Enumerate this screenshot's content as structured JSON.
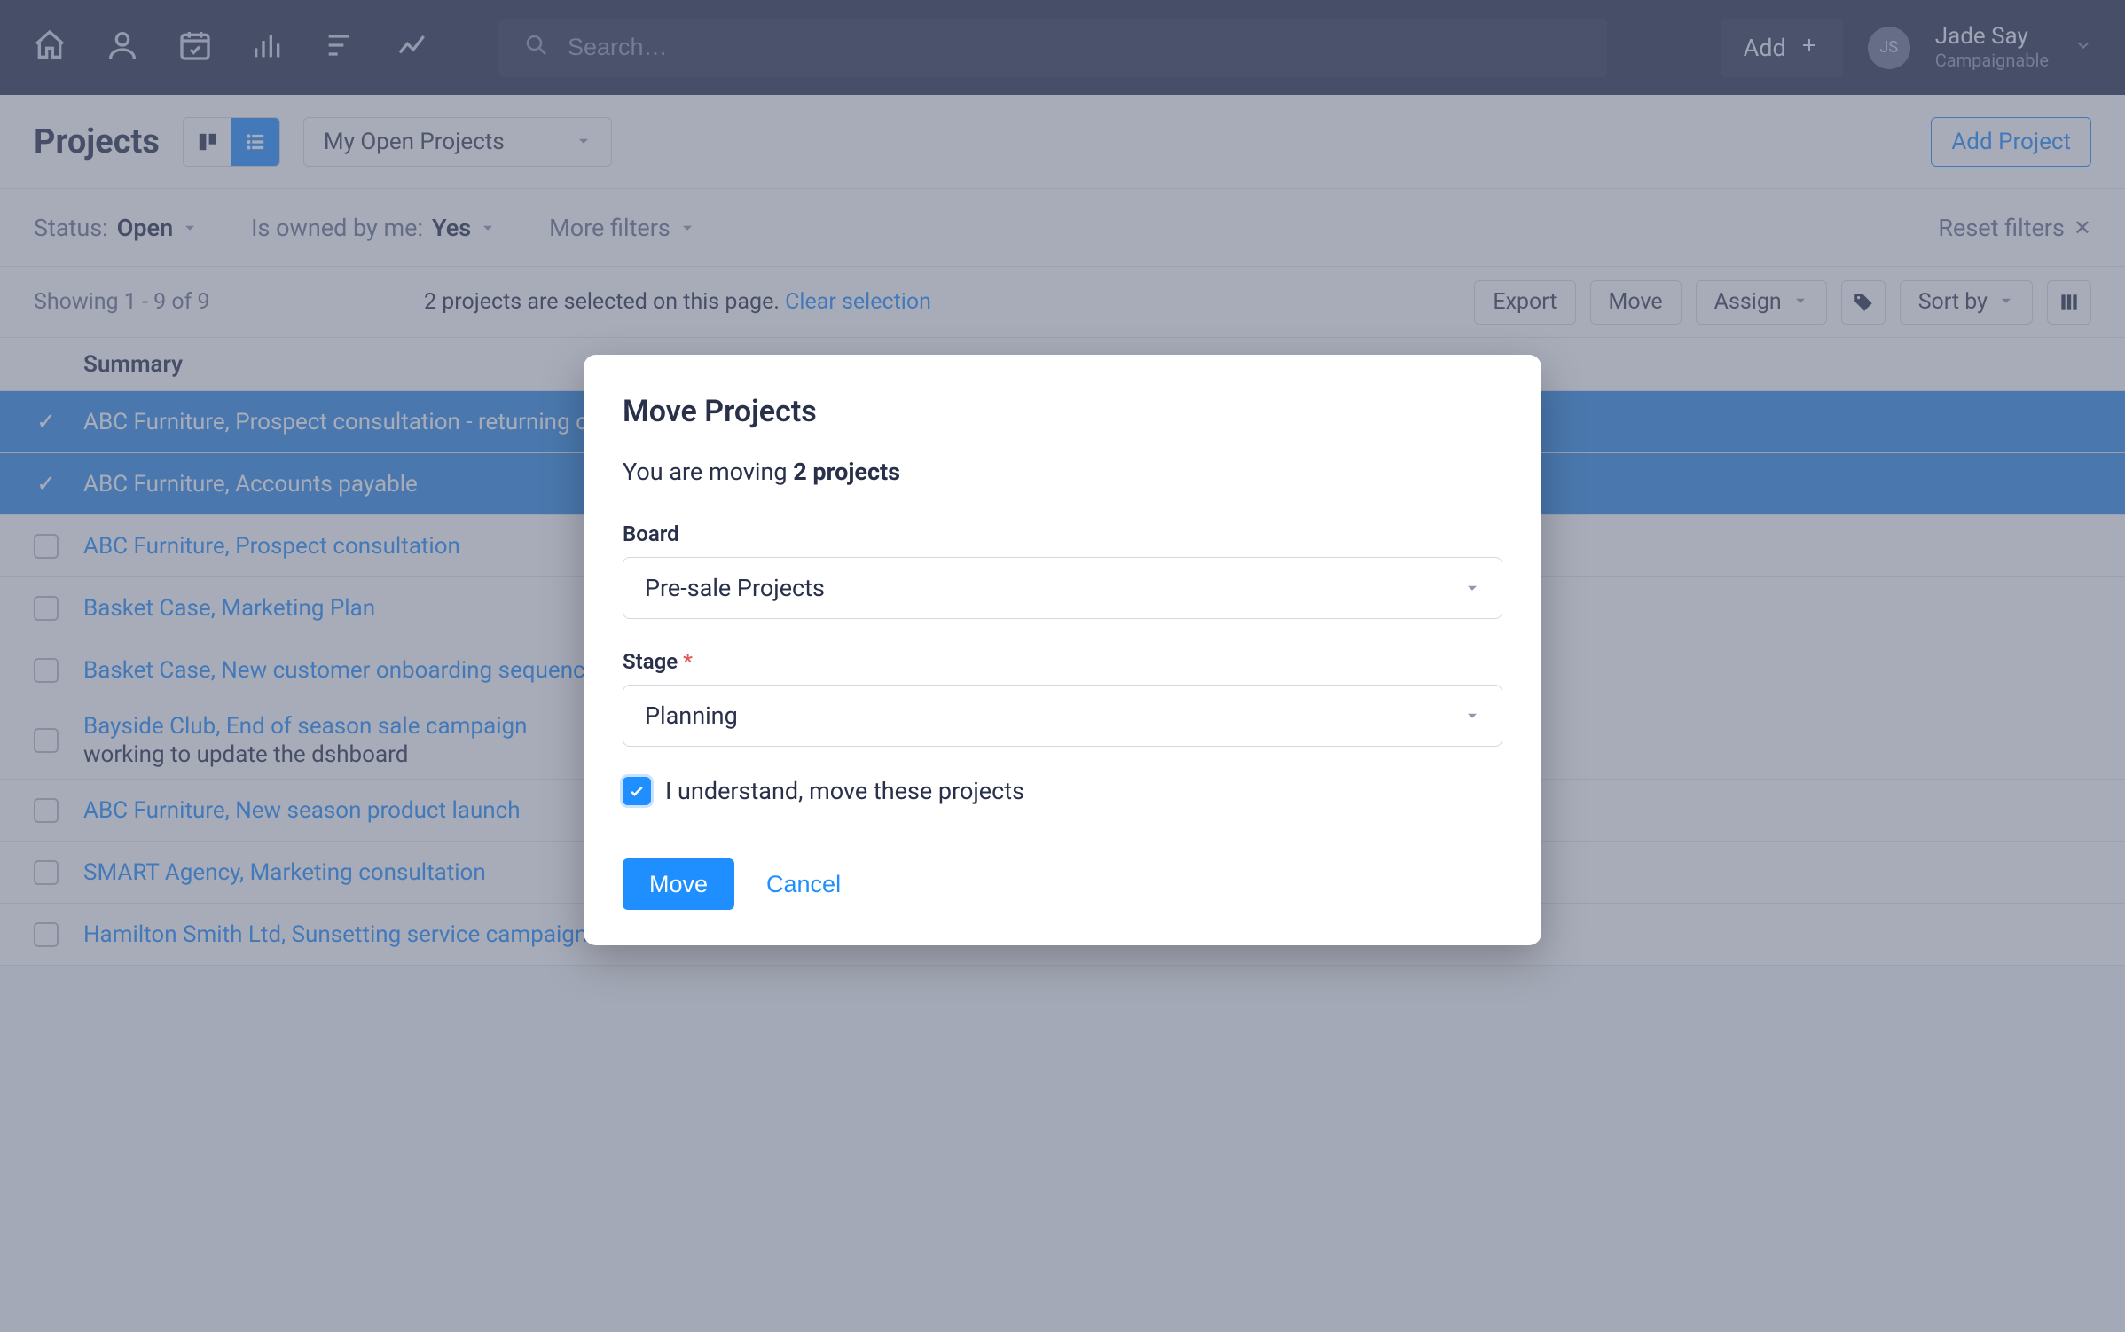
{
  "nav": {
    "search_placeholder": "Search…",
    "add_label": "Add",
    "user_initials": "JS",
    "user_name": "Jade Say",
    "user_org": "Campaignable"
  },
  "subheader": {
    "title": "Projects",
    "filter_dropdown": "My Open Projects",
    "add_project": "Add Project"
  },
  "filters": {
    "status_label": "Status:",
    "status_value": "Open",
    "owned_label": "Is owned by me:",
    "owned_value": "Yes",
    "more_filters": "More filters",
    "reset": "Reset filters"
  },
  "toolbar": {
    "showing": "Showing 1 - 9 of 9",
    "selection_prefix": "2 projects are selected on this page.",
    "clear_selection": "Clear selection",
    "export": "Export",
    "move": "Move",
    "assign": "Assign",
    "sort_by": "Sort by"
  },
  "table": {
    "summary_header": "Summary",
    "rows": [
      {
        "selected": true,
        "title": "ABC Furniture, Prospect consultation - returning customer"
      },
      {
        "selected": true,
        "title": "ABC Furniture, Accounts payable"
      },
      {
        "selected": false,
        "title": "ABC Furniture, Prospect consultation"
      },
      {
        "selected": false,
        "title": "Basket Case, Marketing Plan"
      },
      {
        "selected": false,
        "title": "Basket Case, New customer onboarding sequence"
      },
      {
        "selected": false,
        "title": "Bayside Club, End of season sale campaign",
        "subtitle": "working to update the dshboard"
      },
      {
        "selected": false,
        "title": "ABC Furniture, New season product launch"
      },
      {
        "selected": false,
        "title": "SMART Agency, Marketing consultation"
      },
      {
        "selected": false,
        "title": "Hamilton Smith Ltd, Sunsetting service campaign"
      }
    ]
  },
  "modal": {
    "title": "Move Projects",
    "moving_prefix": "You are moving ",
    "moving_count": "2 projects",
    "board_label": "Board",
    "board_value": "Pre-sale Projects",
    "stage_label": "Stage",
    "stage_required": "*",
    "stage_value": "Planning",
    "consent": "I understand, move these projects",
    "move_btn": "Move",
    "cancel_btn": "Cancel"
  }
}
